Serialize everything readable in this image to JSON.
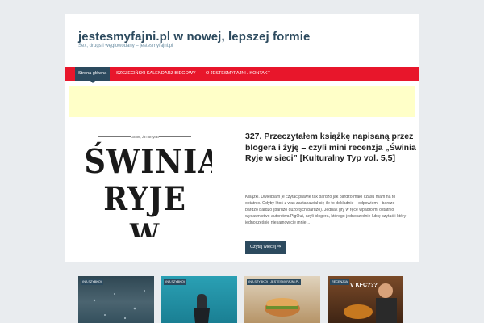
{
  "site": {
    "title": "jestesmyfajni.pl w nowej, lepszej formie",
    "description": "Sex, drugs i węglowodany – jestesmyfajni.pl"
  },
  "nav": {
    "items": [
      {
        "label": "Strona główna",
        "active": true
      },
      {
        "label": "SZCZECIŃSKI KALENDARZ BIEGOWY",
        "active": false
      },
      {
        "label": "O JESTESMYFAJNI / KONTAKT",
        "active": false
      }
    ]
  },
  "featured": {
    "thumb": {
      "caption": "Głodni, Źli i Brzydki",
      "words": [
        "ŚWINIA",
        "RYJE",
        "W SIECI"
      ]
    },
    "title": "327. Przeczytałem książkę napisaną przez blogera i żyję – czyli mini recenzja „Świnia Ryje w sieci” [Kulturalny Typ vol. 5,5]",
    "excerpt": "Książki. Uwielbiam je czytać prawie tak bardzo jak bardzo mało czasu mam na to ostatnio. Gdyby ktoś z was zastanawiał się ile to dokładnie – odpowiem – bardzo bardzo bardzo (bardzo dużo tych bardzo). Jednak gry w ręce wpadło mi ostatnio wydawnictwo autorstwa PigOut, czyli blogera, którego jednocześnie lubię czytać i który jednocześnie niesamowicie mnie…",
    "read_more": "Czytaj więcej ⇒"
  },
  "grid": [
    {
      "badge": "(NA SZYBKO)",
      "title": "",
      "bg": "#3d5561"
    },
    {
      "badge": "(NA SZYBKO)",
      "title": "",
      "bg": "#1f8fa3"
    },
    {
      "badge": "(NA SZYBKO) | JESTESMYFAJNI.PL",
      "title": "",
      "bg": "#c9b28e"
    },
    {
      "badge": "RECENZJA",
      "title": "V KFC???",
      "bg": "#5a3a22"
    }
  ],
  "colors": {
    "accent_red": "#e8162b",
    "navy": "#2c4a5e",
    "ad_yellow": "#ffffc8"
  }
}
